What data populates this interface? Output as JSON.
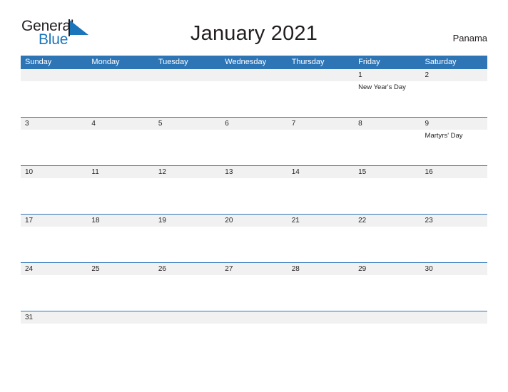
{
  "brand": {
    "name_part1": "General",
    "name_part2": "Blue",
    "flag_icon": "blue-triangle-flag-icon",
    "color_dark": "#231f20",
    "color_blue": "#1b75bb"
  },
  "header": {
    "title": "January 2021",
    "country": "Panama"
  },
  "theme": {
    "header_blue": "#2e75b6",
    "date_strip_gray": "#f1f1f1",
    "row_rule_blue": "#2e75b6",
    "text_dark": "#231f20",
    "text_white": "#ffffff"
  },
  "calendar": {
    "weekdays": [
      "Sunday",
      "Monday",
      "Tuesday",
      "Wednesday",
      "Thursday",
      "Friday",
      "Saturday"
    ],
    "weeks": [
      {
        "days": [
          {
            "number": "",
            "events": []
          },
          {
            "number": "",
            "events": []
          },
          {
            "number": "",
            "events": []
          },
          {
            "number": "",
            "events": []
          },
          {
            "number": "",
            "events": []
          },
          {
            "number": "1",
            "events": [
              "New Year's Day"
            ]
          },
          {
            "number": "2",
            "events": []
          }
        ]
      },
      {
        "days": [
          {
            "number": "3",
            "events": []
          },
          {
            "number": "4",
            "events": []
          },
          {
            "number": "5",
            "events": []
          },
          {
            "number": "6",
            "events": []
          },
          {
            "number": "7",
            "events": []
          },
          {
            "number": "8",
            "events": []
          },
          {
            "number": "9",
            "events": [
              "Martyrs' Day"
            ]
          }
        ]
      },
      {
        "days": [
          {
            "number": "10",
            "events": []
          },
          {
            "number": "11",
            "events": []
          },
          {
            "number": "12",
            "events": []
          },
          {
            "number": "13",
            "events": []
          },
          {
            "number": "14",
            "events": []
          },
          {
            "number": "15",
            "events": []
          },
          {
            "number": "16",
            "events": []
          }
        ]
      },
      {
        "days": [
          {
            "number": "17",
            "events": []
          },
          {
            "number": "18",
            "events": []
          },
          {
            "number": "19",
            "events": []
          },
          {
            "number": "20",
            "events": []
          },
          {
            "number": "21",
            "events": []
          },
          {
            "number": "22",
            "events": []
          },
          {
            "number": "23",
            "events": []
          }
        ]
      },
      {
        "days": [
          {
            "number": "24",
            "events": []
          },
          {
            "number": "25",
            "events": []
          },
          {
            "number": "26",
            "events": []
          },
          {
            "number": "27",
            "events": []
          },
          {
            "number": "28",
            "events": []
          },
          {
            "number": "29",
            "events": []
          },
          {
            "number": "30",
            "events": []
          }
        ]
      },
      {
        "days": [
          {
            "number": "31",
            "events": []
          },
          {
            "number": "",
            "events": []
          },
          {
            "number": "",
            "events": []
          },
          {
            "number": "",
            "events": []
          },
          {
            "number": "",
            "events": []
          },
          {
            "number": "",
            "events": []
          },
          {
            "number": "",
            "events": []
          }
        ]
      }
    ]
  }
}
